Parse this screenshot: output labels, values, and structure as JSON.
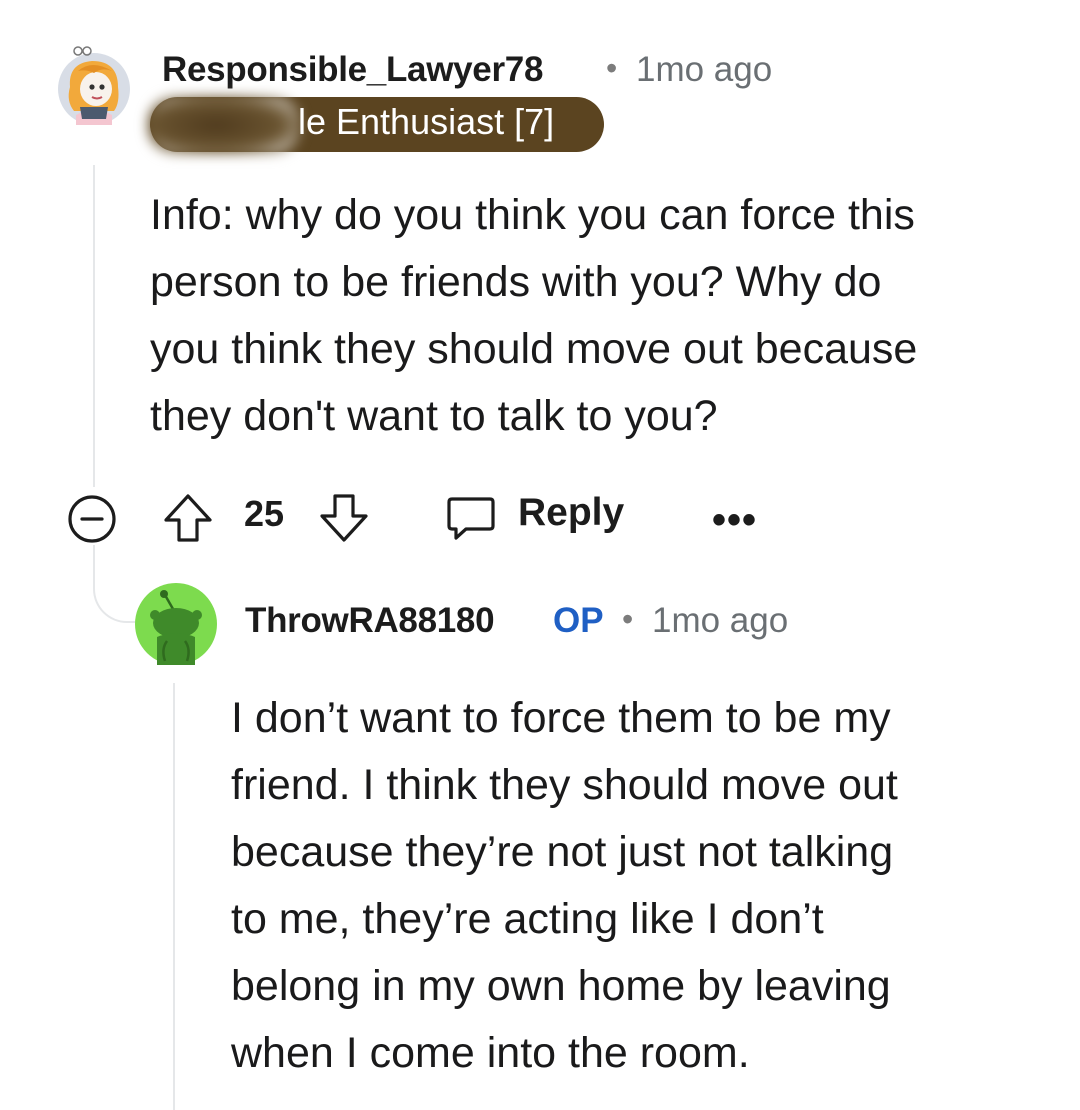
{
  "comment": {
    "username": "Responsible_Lawyer78",
    "separator": "•",
    "timestamp": "1mo ago",
    "flair": "le Enthusiast [7]",
    "body_lines": [
      "Info: why do you think you can force this",
      "person to be friends with you? Why do",
      "you think they should move out because",
      "they don't want to talk to you?"
    ],
    "score": "25",
    "reply_label": "Reply",
    "more_label": "•••",
    "flair_color": "#5b4420"
  },
  "reply": {
    "username": "ThrowRA88180",
    "op_badge": "OP",
    "separator": "•",
    "timestamp": "1mo ago",
    "body_lines": [
      "I don’t want to force them to be my",
      "friend. I think they should move out",
      "because they’re not just not talking",
      "to me, they’re acting like I don’t",
      "belong in my own home by leaving",
      "when I come into the room."
    ],
    "op_color": "#1f5fc4",
    "avatar_color": "#7ddb4e"
  },
  "icons": {
    "avatar1": "cartoon-avatar-icon",
    "avatar2": "snoo-avatar-icon",
    "collapse": "minus-circle-icon",
    "upvote": "upvote-arrow-icon",
    "downvote": "downvote-arrow-icon",
    "reply": "speech-bubble-icon",
    "more": "more-dots-icon"
  }
}
